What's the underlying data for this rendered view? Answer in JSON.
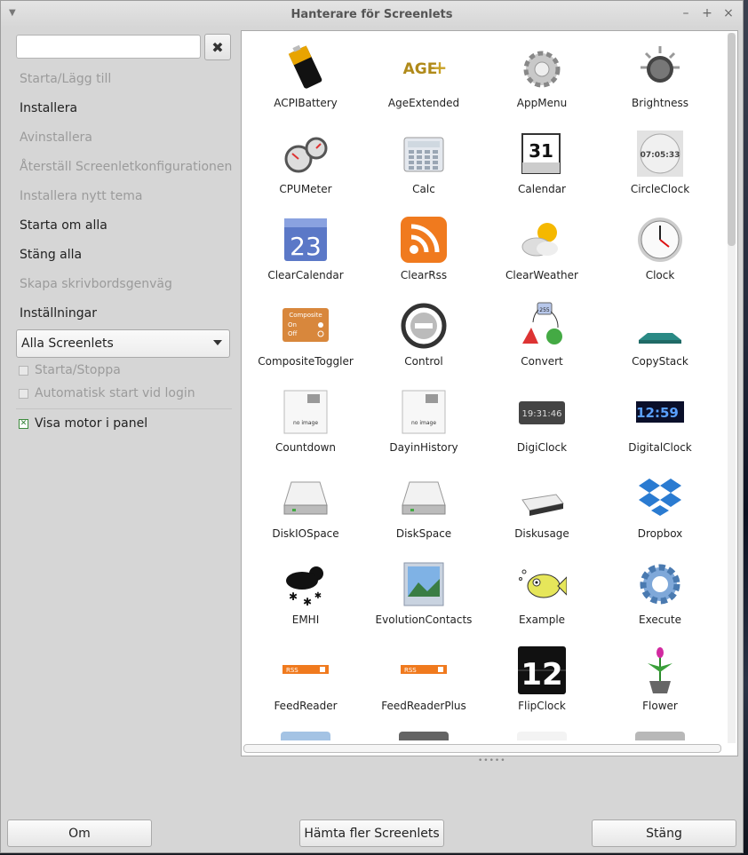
{
  "window": {
    "title": "Hanterare för Screenlets",
    "ctrl_min": "–",
    "ctrl_max": "+",
    "ctrl_close": "×"
  },
  "search": {
    "value": "",
    "placeholder": "",
    "clear_icon": "clear-icon"
  },
  "actions": [
    {
      "label": "Starta/Lägg till",
      "enabled": false
    },
    {
      "label": "Installera",
      "enabled": true
    },
    {
      "label": "Avinstallera",
      "enabled": false
    },
    {
      "label": "Återställ Screenletkonfigurationen",
      "enabled": false
    },
    {
      "label": "Installera nytt tema",
      "enabled": false
    },
    {
      "label": "Starta om alla",
      "enabled": true
    },
    {
      "label": "Stäng alla",
      "enabled": true
    },
    {
      "label": "Skapa skrivbordsgenväg",
      "enabled": false
    },
    {
      "label": "Inställningar",
      "enabled": true
    }
  ],
  "filter": {
    "selected": "Alla Screenlets"
  },
  "options": {
    "start_stop": {
      "label": "Starta/Stoppa",
      "checked": false,
      "enabled": false
    },
    "autostart": {
      "label": "Automatisk start vid login",
      "checked": false,
      "enabled": false
    },
    "show_engine": {
      "label": "Visa motor i panel",
      "checked": true,
      "enabled": true
    }
  },
  "screenlets": [
    {
      "name": "ACPIBattery",
      "icon": "battery-icon"
    },
    {
      "name": "AgeExtended",
      "icon": "age-plus-icon"
    },
    {
      "name": "AppMenu",
      "icon": "gear-menu-icon"
    },
    {
      "name": "Brightness",
      "icon": "brightness-knob-icon"
    },
    {
      "name": "CPUMeter",
      "icon": "gauge-icon"
    },
    {
      "name": "Calc",
      "icon": "calculator-icon"
    },
    {
      "name": "Calendar",
      "icon": "calendar-icon",
      "icon_text": "31"
    },
    {
      "name": "CircleClock",
      "icon": "clock-face-icon",
      "icon_text": "07:05:33"
    },
    {
      "name": "ClearCalendar",
      "icon": "blue-calendar-icon",
      "icon_text": "23"
    },
    {
      "name": "ClearRss",
      "icon": "rss-icon"
    },
    {
      "name": "ClearWeather",
      "icon": "weather-sun-cloud-icon"
    },
    {
      "name": "Clock",
      "icon": "analog-clock-icon"
    },
    {
      "name": "CompositeToggler",
      "icon": "toggle-panel-icon",
      "icon_lines": [
        "Composite",
        "On",
        "Off"
      ]
    },
    {
      "name": "Control",
      "icon": "stop-circle-icon"
    },
    {
      "name": "Convert",
      "icon": "color-convert-icon",
      "icon_text": "255"
    },
    {
      "name": "CopyStack",
      "icon": "stack-tray-icon"
    },
    {
      "name": "Countdown",
      "icon": "no-image-icon",
      "icon_text": "no image"
    },
    {
      "name": "DayinHistory",
      "icon": "no-image-icon",
      "icon_text": "no image"
    },
    {
      "name": "DigiClock",
      "icon": "digital-display-icon",
      "icon_text": "19:31:46"
    },
    {
      "name": "DigitalClock",
      "icon": "blue-digital-clock-icon",
      "icon_text": "12:59"
    },
    {
      "name": "DiskIOSpace",
      "icon": "drive-icon"
    },
    {
      "name": "DiskSpace",
      "icon": "drive-icon"
    },
    {
      "name": "Diskusage",
      "icon": "external-drive-icon"
    },
    {
      "name": "Dropbox",
      "icon": "dropbox-icon"
    },
    {
      "name": "EMHI",
      "icon": "snow-storm-icon"
    },
    {
      "name": "EvolutionContacts",
      "icon": "photo-frame-icon"
    },
    {
      "name": "Example",
      "icon": "fish-icon"
    },
    {
      "name": "Execute",
      "icon": "blue-gear-icon"
    },
    {
      "name": "FeedReader",
      "icon": "rss-bar-icon",
      "icon_text": "RSS"
    },
    {
      "name": "FeedReaderPlus",
      "icon": "rss-bar-icon",
      "icon_text": "RSS"
    },
    {
      "name": "FlipClock",
      "icon": "flip-clock-icon",
      "icon_text": "12"
    },
    {
      "name": "Flower",
      "icon": "flower-pot-icon"
    }
  ],
  "footer": {
    "about": "Om",
    "get_more": "Hämta fler Screenlets",
    "close": "Stäng"
  }
}
